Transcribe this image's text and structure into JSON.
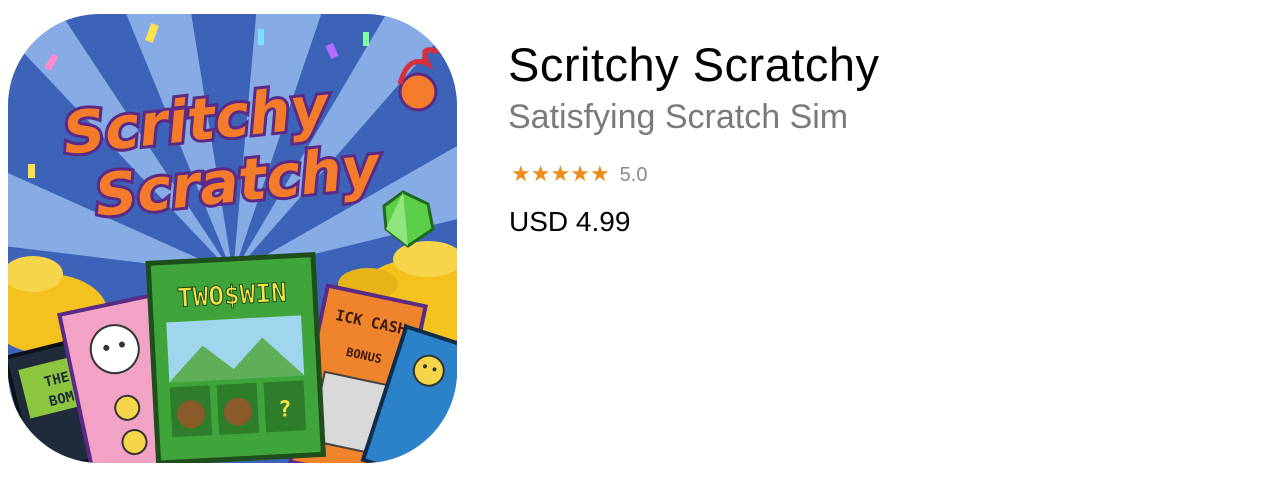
{
  "app": {
    "title": "Scritchy Scratchy",
    "subtitle": "Satisfying Scratch Sim",
    "rating": {
      "value": "5.0",
      "stars": 5,
      "star_glyph": "★",
      "star_color": "#ef8b1d"
    },
    "price": "USD 4.99"
  },
  "icon_art": {
    "logo_line1": "Scritchy",
    "logo_line2": "Scratchy",
    "center_card_text": "TWO$WIN",
    "left_card_text_1": "THE",
    "left_card_text_2": "BOM",
    "right_card_text": "ICK CASH",
    "right_card_sub": "BONUS",
    "colors": {
      "background": "#3d63b8",
      "logo": "#f37b2a",
      "logo_outline": "#5b2a86",
      "center_card": "#3fa53a",
      "pink_card": "#f2a3c5",
      "orange_card": "#f0842c",
      "coins": "#f3c21e",
      "gem": "#5ccf4a"
    }
  }
}
